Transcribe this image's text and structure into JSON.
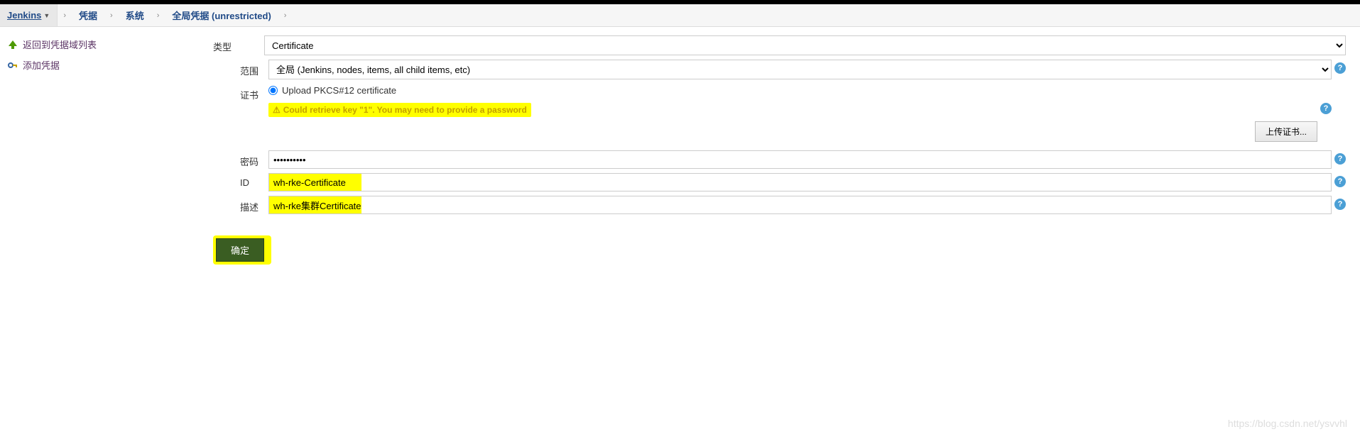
{
  "breadcrumbs": {
    "items": [
      "Jenkins",
      "凭据",
      "系统",
      "全局凭据 (unrestricted)"
    ]
  },
  "sidebar": {
    "back_label": "返回到凭据域列表",
    "add_label": "添加凭据"
  },
  "form": {
    "type_label": "类型",
    "type_value": "Certificate",
    "scope_label": "范围",
    "scope_value": "全局 (Jenkins, nodes, items, all child items, etc)",
    "cert_label": "证书",
    "cert_radio_label": "Upload PKCS#12 certificate",
    "warning_text": "Could retrieve key \"1\". You may need to provide a password",
    "upload_btn": "上传证书...",
    "password_label": "密码",
    "password_value": "••••••••••",
    "id_label": "ID",
    "id_value": "wh-rke-Certificate",
    "desc_label": "描述",
    "desc_value": "wh-rke集群Certificate",
    "submit_label": "确定"
  },
  "watermark": "https://blog.csdn.net/ysvvhl"
}
